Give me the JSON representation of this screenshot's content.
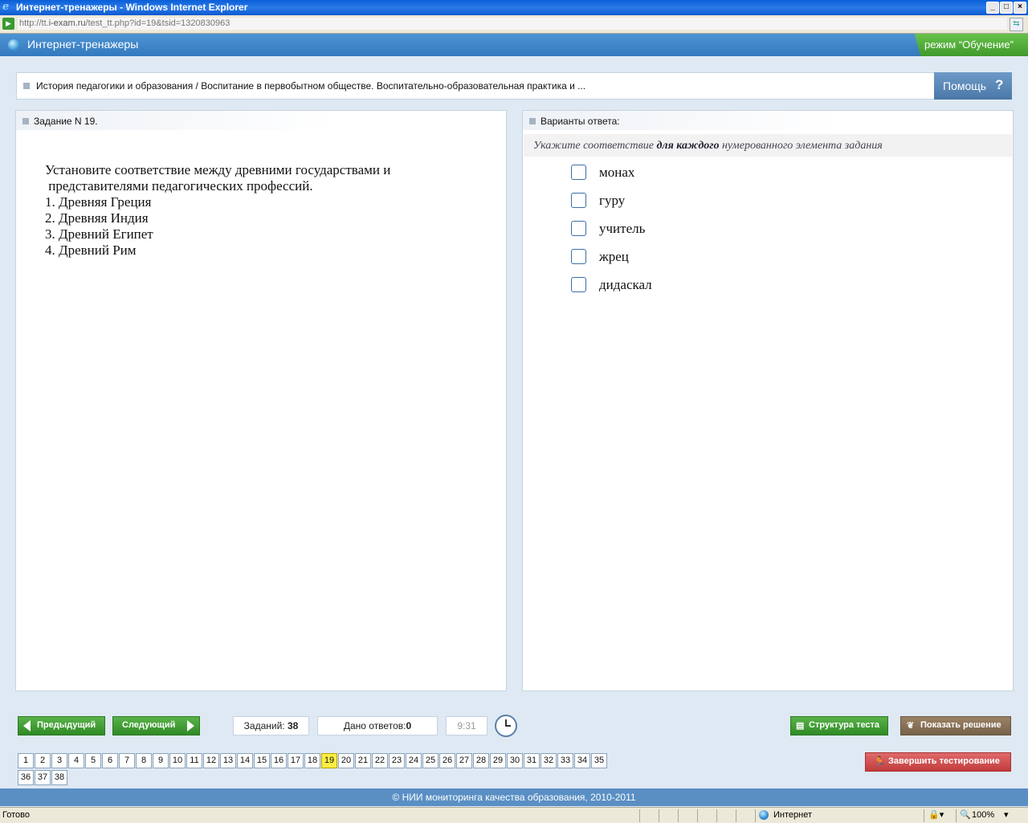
{
  "window": {
    "title": "Интернет-тренажеры - Windows Internet Explorer",
    "minimize": "_",
    "maximize": "□",
    "close": "×"
  },
  "address": {
    "prefix": "http://tt.",
    "domain": "i-exam.ru",
    "path": "/test_tt.php?id=19&tsid=1320830963"
  },
  "header": {
    "app_title": "Интернет-тренажеры",
    "mode": "режим “Обучение”"
  },
  "breadcrumb": "История педагогики и образования / Воспитание в первобытном обществе. Воспитательно-образовательная практика и ...",
  "help": {
    "label": "Помощь",
    "icon": "?"
  },
  "task": {
    "title": "Задание N 19.",
    "text": "Установите соответствие между древними государствами и\n представителями педагогических профессий.\n1. Древняя Греция\n2. Древняя Индия\n3. Древний Египет\n4. Древний Рим"
  },
  "answers": {
    "title": "Варианты ответа:",
    "instruction_pre": "Укажите соответствие ",
    "instruction_bold": "для каждого",
    "instruction_post": " нумерованного элемента задания",
    "options": [
      "монах",
      "гуру",
      "учитель",
      "жрец",
      "дидаскал"
    ]
  },
  "nav": {
    "prev": "Предыдущий",
    "next": "Следующий",
    "tasks_label": "Заданий: ",
    "tasks_count": "38",
    "answers_label": "Дано ответов:",
    "answers_count": "0",
    "timer": "9:31",
    "structure": "Структура теста",
    "solution": "Показать решение",
    "finish": "Завершить тестирование",
    "current_page": "19",
    "pages": [
      "1",
      "2",
      "3",
      "4",
      "5",
      "6",
      "7",
      "8",
      "9",
      "10",
      "11",
      "12",
      "13",
      "14",
      "15",
      "16",
      "17",
      "18",
      "19",
      "20",
      "21",
      "22",
      "23",
      "24",
      "25",
      "26",
      "27",
      "28",
      "29",
      "30",
      "31",
      "32",
      "33",
      "34",
      "35",
      "36",
      "37",
      "38"
    ]
  },
  "footer": "© НИИ мониторинга качества образования, 2010-2011",
  "status": {
    "left": "Готово",
    "zone": "Интернет",
    "zoom": "100%"
  },
  "colors": {
    "header": "#3a82c6",
    "mode_green": "#4fa83a",
    "nav_green": "#3f9a2f",
    "finish_red": "#c94444",
    "current_page": "#ffee40"
  }
}
